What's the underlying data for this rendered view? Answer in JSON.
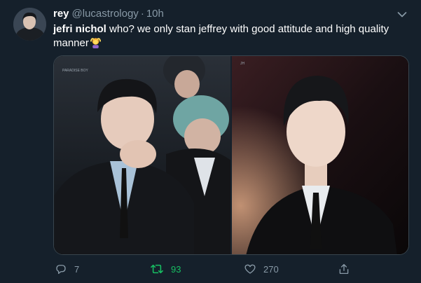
{
  "tweet": {
    "display_name": "rey",
    "handle": "@lucastrology",
    "separator": "·",
    "time": "10h",
    "mention": "jefri nichol",
    "text": "who? we only stan jeffrey with good attitude and high quality manner",
    "emoji": "woman-gesturing-ok-emoji"
  },
  "media": {
    "photos": [
      {
        "watermark": "PARADISE BOY"
      },
      {
        "watermark": "JH"
      }
    ]
  },
  "actions": {
    "reply_count": "7",
    "retweet_count": "93",
    "like_count": "270",
    "retweeted": true
  },
  "colors": {
    "background": "#15202b",
    "secondary_text": "#8899a6",
    "retweet_green": "#17bf63",
    "border": "#38444d"
  }
}
